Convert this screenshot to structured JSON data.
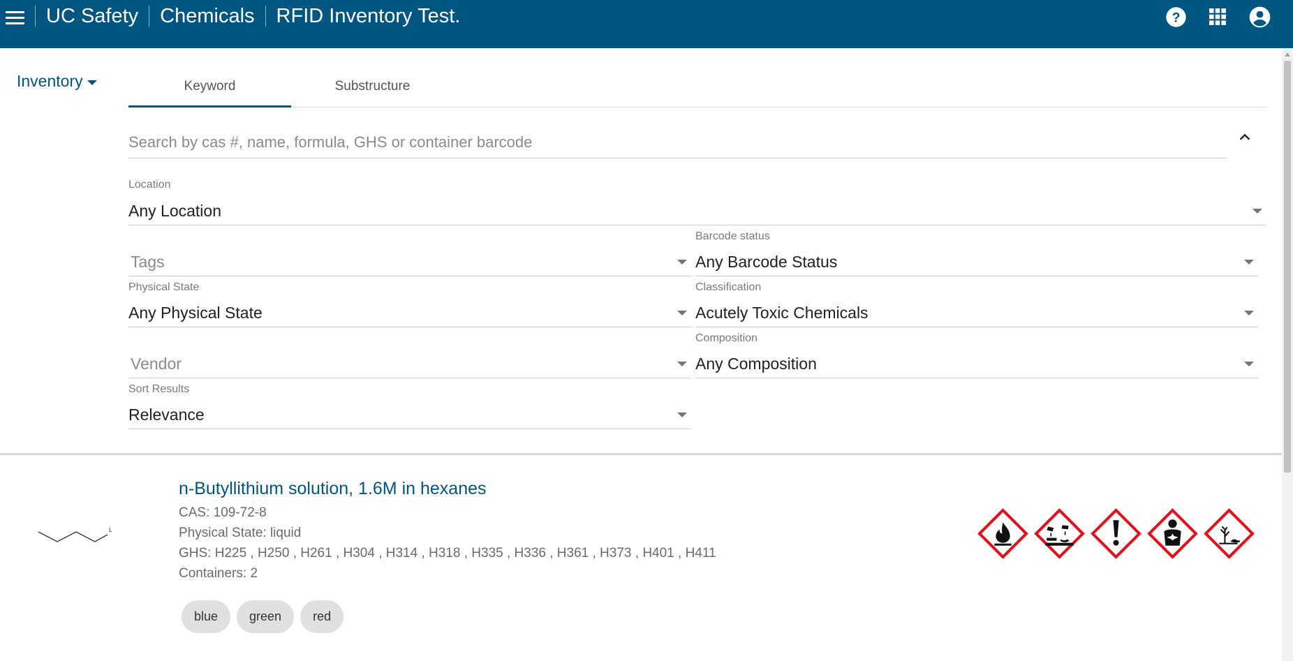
{
  "header": {
    "breadcrumbs": [
      "UC Safety",
      "Chemicals",
      "RFID Inventory Test."
    ],
    "icons": [
      "menu-icon",
      "help-icon",
      "apps-grid-icon",
      "account-circle-icon"
    ],
    "brand_color": "#005581"
  },
  "nav": {
    "inventory_label": "Inventory"
  },
  "tabs": [
    {
      "label": "Keyword",
      "active": true
    },
    {
      "label": "Substructure",
      "active": false
    }
  ],
  "search": {
    "placeholder": "Search by cas #, name, formula, GHS or container barcode",
    "value": ""
  },
  "filters": {
    "location": {
      "label": "Location",
      "value": "Any Location"
    },
    "tags": {
      "placeholder": "Tags"
    },
    "barcode_status": {
      "label": "Barcode status",
      "value": "Any Barcode Status"
    },
    "physical_state": {
      "label": "Physical State",
      "value": "Any Physical State"
    },
    "classification": {
      "label": "Classification",
      "value": "Acutely Toxic Chemicals"
    },
    "vendor": {
      "placeholder": "Vendor"
    },
    "composition": {
      "label": "Composition",
      "value": "Any Composition"
    },
    "sort": {
      "label": "Sort Results",
      "value": "Relevance"
    }
  },
  "result": {
    "title": "n-Butyllithium solution, 1.6M in hexanes",
    "cas": "CAS: 109-72-8",
    "physical_state": "Physical State: liquid",
    "ghs": "GHS: H225 , H250 , H261 , H304 , H314 , H318 , H335 , H336 , H361 , H373 , H401 , H411",
    "containers": "Containers: 2",
    "structure_label": "Li",
    "ghs_pictograms": [
      "flame-icon",
      "corrosion-icon",
      "exclamation-mark-icon",
      "health-hazard-icon",
      "environment-icon"
    ],
    "tags": [
      "blue",
      "green",
      "red"
    ]
  }
}
